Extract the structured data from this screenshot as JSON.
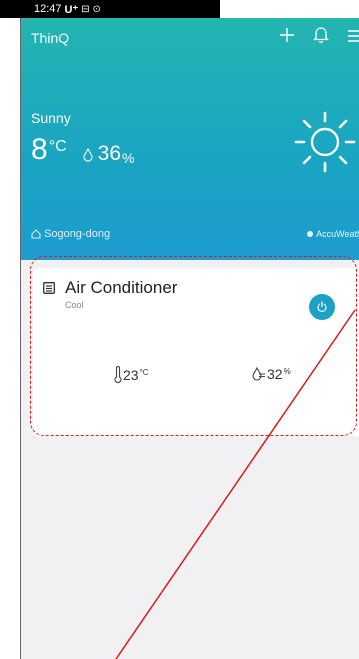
{
  "status_bar": {
    "time": "12:47",
    "carrier": "U⁺",
    "icons": "⊟ ⊙"
  },
  "header": {
    "app_title": "ThinQ",
    "add_icon": "＋",
    "bell_icon": "🔔",
    "menu_icon": "☰"
  },
  "weather": {
    "condition": "Sunny",
    "temperature": "8",
    "temperature_unit": "°C",
    "humidity": "36",
    "humidity_unit": "%",
    "location": "Sogong-dong",
    "provider": "AccuWeather"
  },
  "device_card": {
    "name": "Air Conditioner",
    "mode": "Cool",
    "temperature": "23",
    "temperature_unit": "°C",
    "humidity": "32",
    "humidity_unit": "%"
  },
  "colors": {
    "accent": "#1ba1c6",
    "hero_top": "#23b5b0",
    "hero_bottom": "#1d9cce",
    "annotation": "#e0191a"
  }
}
